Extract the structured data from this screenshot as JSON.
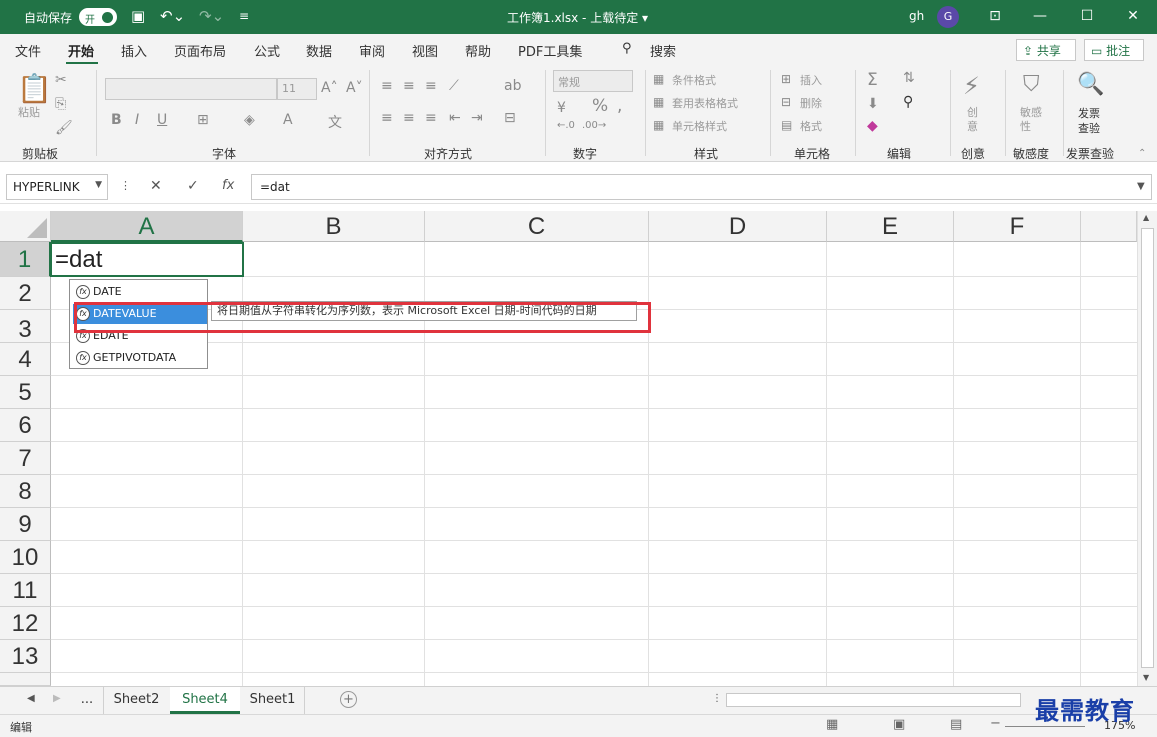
{
  "titlebar": {
    "autosave_label": "自动保存",
    "autosave_state": "开",
    "title": "工作簿1.xlsx - 上载待定 ▾",
    "user": "gh",
    "avatar_initial": "G"
  },
  "menu": {
    "items": [
      "文件",
      "开始",
      "插入",
      "页面布局",
      "公式",
      "数据",
      "审阅",
      "视图",
      "帮助",
      "PDF工具集"
    ],
    "search": "搜索",
    "share": "共享",
    "comments": "批注"
  },
  "ribbon": {
    "groups": [
      "剪贴板",
      "字体",
      "对齐方式",
      "数字",
      "样式",
      "单元格",
      "编辑",
      "创意",
      "敏感度",
      "发票查验"
    ],
    "paste": "粘贴",
    "font_size": "11",
    "number_format": "常规",
    "cond_format": "条件格式",
    "table_format": "套用表格格式",
    "cell_style": "单元格样式",
    "insert": "插入",
    "delete": "删除",
    "format": "格式",
    "creative": "创意",
    "sensitivity": "敏感性",
    "invoice_line1": "发票",
    "invoice_line2": "查验"
  },
  "formula_bar": {
    "name_box": "HYPERLINK",
    "fx": "fx",
    "formula": "=dat"
  },
  "grid": {
    "columns": [
      "A",
      "B",
      "C",
      "D",
      "E",
      "F"
    ],
    "rows": [
      "1",
      "2",
      "3",
      "4",
      "5",
      "6",
      "7",
      "8",
      "9",
      "10",
      "11",
      "12",
      "13"
    ],
    "active_cell_value": "=dat"
  },
  "autocomplete": {
    "items": [
      "DATE",
      "DATEVALUE",
      "EDATE",
      "GETPIVOTDATA"
    ],
    "selected_index": 1,
    "tooltip": "将日期值从字符串转化为序列数，表示 Microsoft Excel 日期-时间代码的日期"
  },
  "sheets": {
    "tabs": [
      "...",
      "Sheet2",
      "Sheet4",
      "Sheet1"
    ],
    "active": "Sheet4"
  },
  "status": {
    "mode": "编辑",
    "zoom": "175%"
  },
  "watermark": "最需教育",
  "colors": {
    "accent": "#217346",
    "highlight": "#3b8edd",
    "annotation": "#e0333d"
  }
}
